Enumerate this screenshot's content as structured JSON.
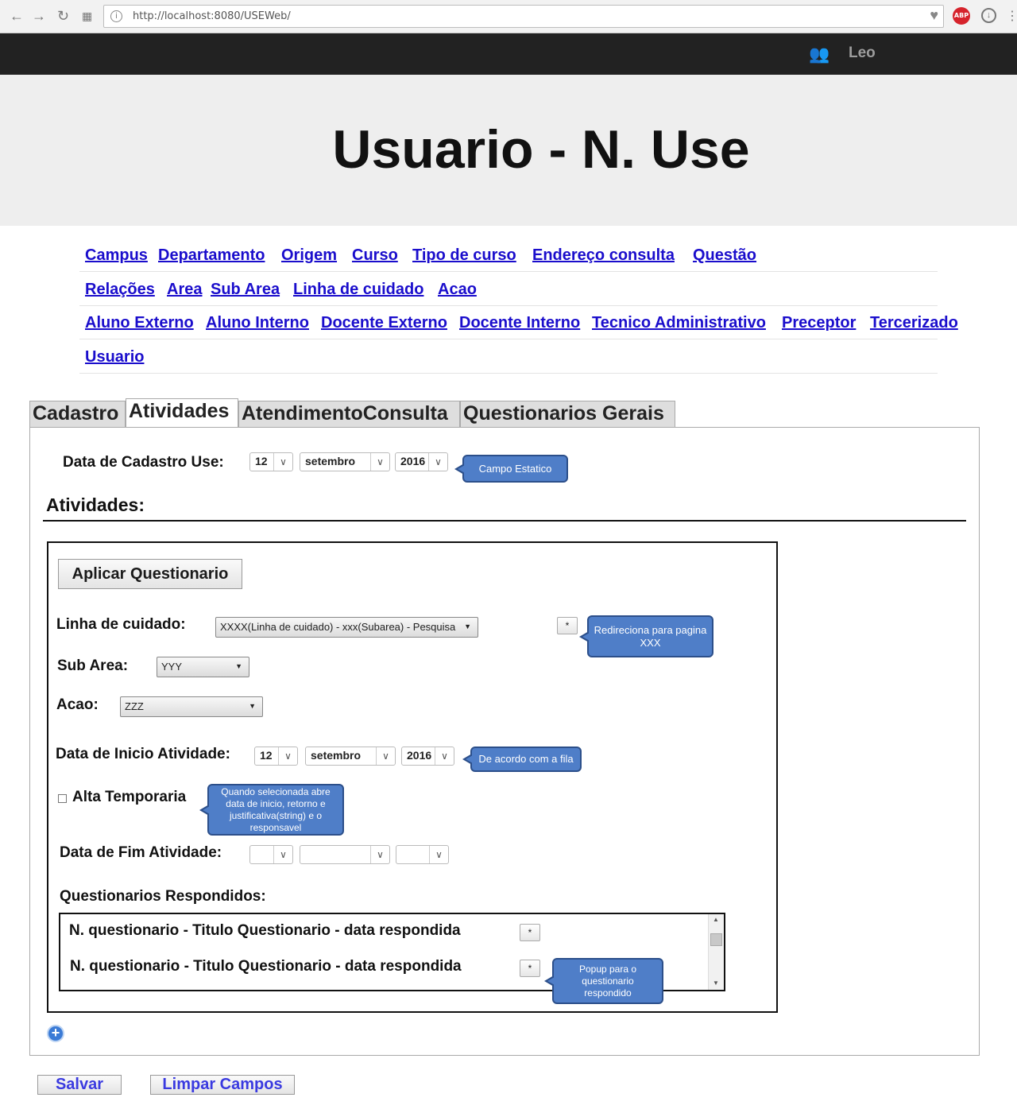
{
  "browser": {
    "url": "http://localhost:8080/USEWeb/"
  },
  "header": {
    "user_name": "Leo",
    "title": "Usuario - N. Use"
  },
  "nav": {
    "row1": [
      "Campus",
      "Departamento",
      "Origem",
      "Curso",
      "Tipo de curso",
      "Endereço consulta",
      "Questão"
    ],
    "row2": [
      "Relações",
      "Area",
      "Sub Area",
      "Linha de cuidado",
      "Acao"
    ],
    "row3": [
      "Aluno Externo",
      "Aluno Interno",
      "Docente Externo",
      "Docente Interno",
      "Tecnico Administrativo",
      "Preceptor",
      "Tercerizado"
    ],
    "row4": [
      "Usuario"
    ]
  },
  "tabs": [
    "Cadastro",
    "Atividades",
    "AtendimentoConsulta",
    "Questionarios Gerais"
  ],
  "active_tab": "Atividades",
  "form": {
    "data_cadastro_label": "Data de Cadastro Use:",
    "data_cadastro": {
      "day": "12",
      "month": "setembro",
      "year": "2016"
    },
    "section_title": "Atividades:",
    "aplicar_button": "Aplicar Questionario",
    "linha_label": "Linha de cuidado:",
    "linha_value": "XXXX(Linha de cuidado) - xxx(Subarea) - Pesquisa",
    "subarea_label": "Sub Area:",
    "subarea_value": "YYY",
    "acao_label": "Acao:",
    "acao_value": "ZZZ",
    "data_inicio_label": "Data de Inicio Atividade:",
    "data_inicio": {
      "day": "12",
      "month": "setembro",
      "year": "2016"
    },
    "alta_label": "Alta Temporaria",
    "alta_checked": false,
    "data_fim_label": "Data de Fim Atividade:",
    "data_fim": {
      "day": "",
      "month": "",
      "year": ""
    },
    "questionarios_label": "Questionarios Respondidos:",
    "questionarios": [
      "N. questionario - Titulo Questionario - data respondida",
      "N. questionario - Titulo Questionario - data respondida"
    ],
    "star": "*"
  },
  "callouts": {
    "campo_estatico": "Campo Estatico",
    "redireciona": "Redireciona para pagina XXX",
    "fila": "De acordo com a fila",
    "alta": "Quando selecionada abre data de inicio, retorno e justificativa(string) e o responsavel",
    "popup": "Popup para o questionario respondido"
  },
  "actions": {
    "save": "Salvar",
    "clear": "Limpar Campos"
  }
}
